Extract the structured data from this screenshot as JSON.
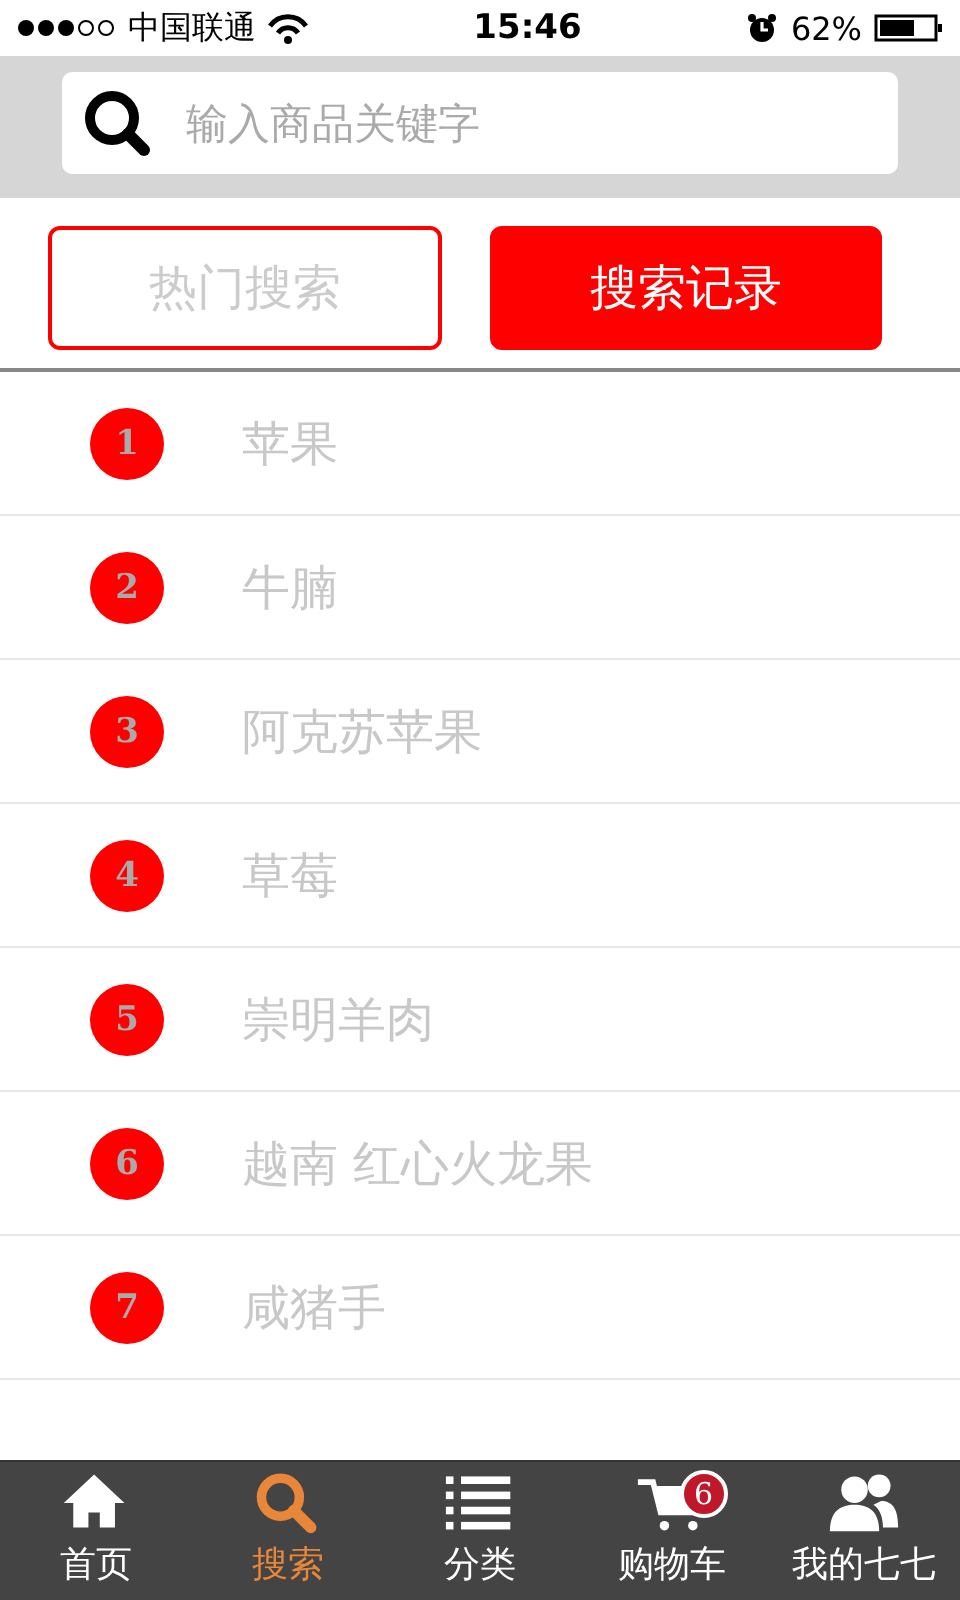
{
  "status_bar": {
    "carrier": "中国联通",
    "time": "15:46",
    "battery": "62%"
  },
  "search": {
    "placeholder": "输入商品关键字"
  },
  "tabs": [
    {
      "label": "热门搜索",
      "selected": false
    },
    {
      "label": "搜索记录",
      "selected": true
    }
  ],
  "list": [
    {
      "rank": "1",
      "text": "苹果"
    },
    {
      "rank": "2",
      "text": "牛腩"
    },
    {
      "rank": "3",
      "text": "阿克苏苹果"
    },
    {
      "rank": "4",
      "text": "草莓"
    },
    {
      "rank": "5",
      "text": "崇明羊肉"
    },
    {
      "rank": "6",
      "text": "越南 红心火龙果"
    },
    {
      "rank": "7",
      "text": "咸猪手"
    }
  ],
  "tab_bar": [
    {
      "kind": "home",
      "label": "首页",
      "selected": false
    },
    {
      "kind": "search",
      "label": "搜索",
      "selected": true
    },
    {
      "kind": "list",
      "label": "分类",
      "selected": false
    },
    {
      "kind": "cart",
      "label": "购物车",
      "selected": false,
      "badge": "6"
    },
    {
      "kind": "user",
      "label": "我的七七",
      "selected": false
    }
  ]
}
